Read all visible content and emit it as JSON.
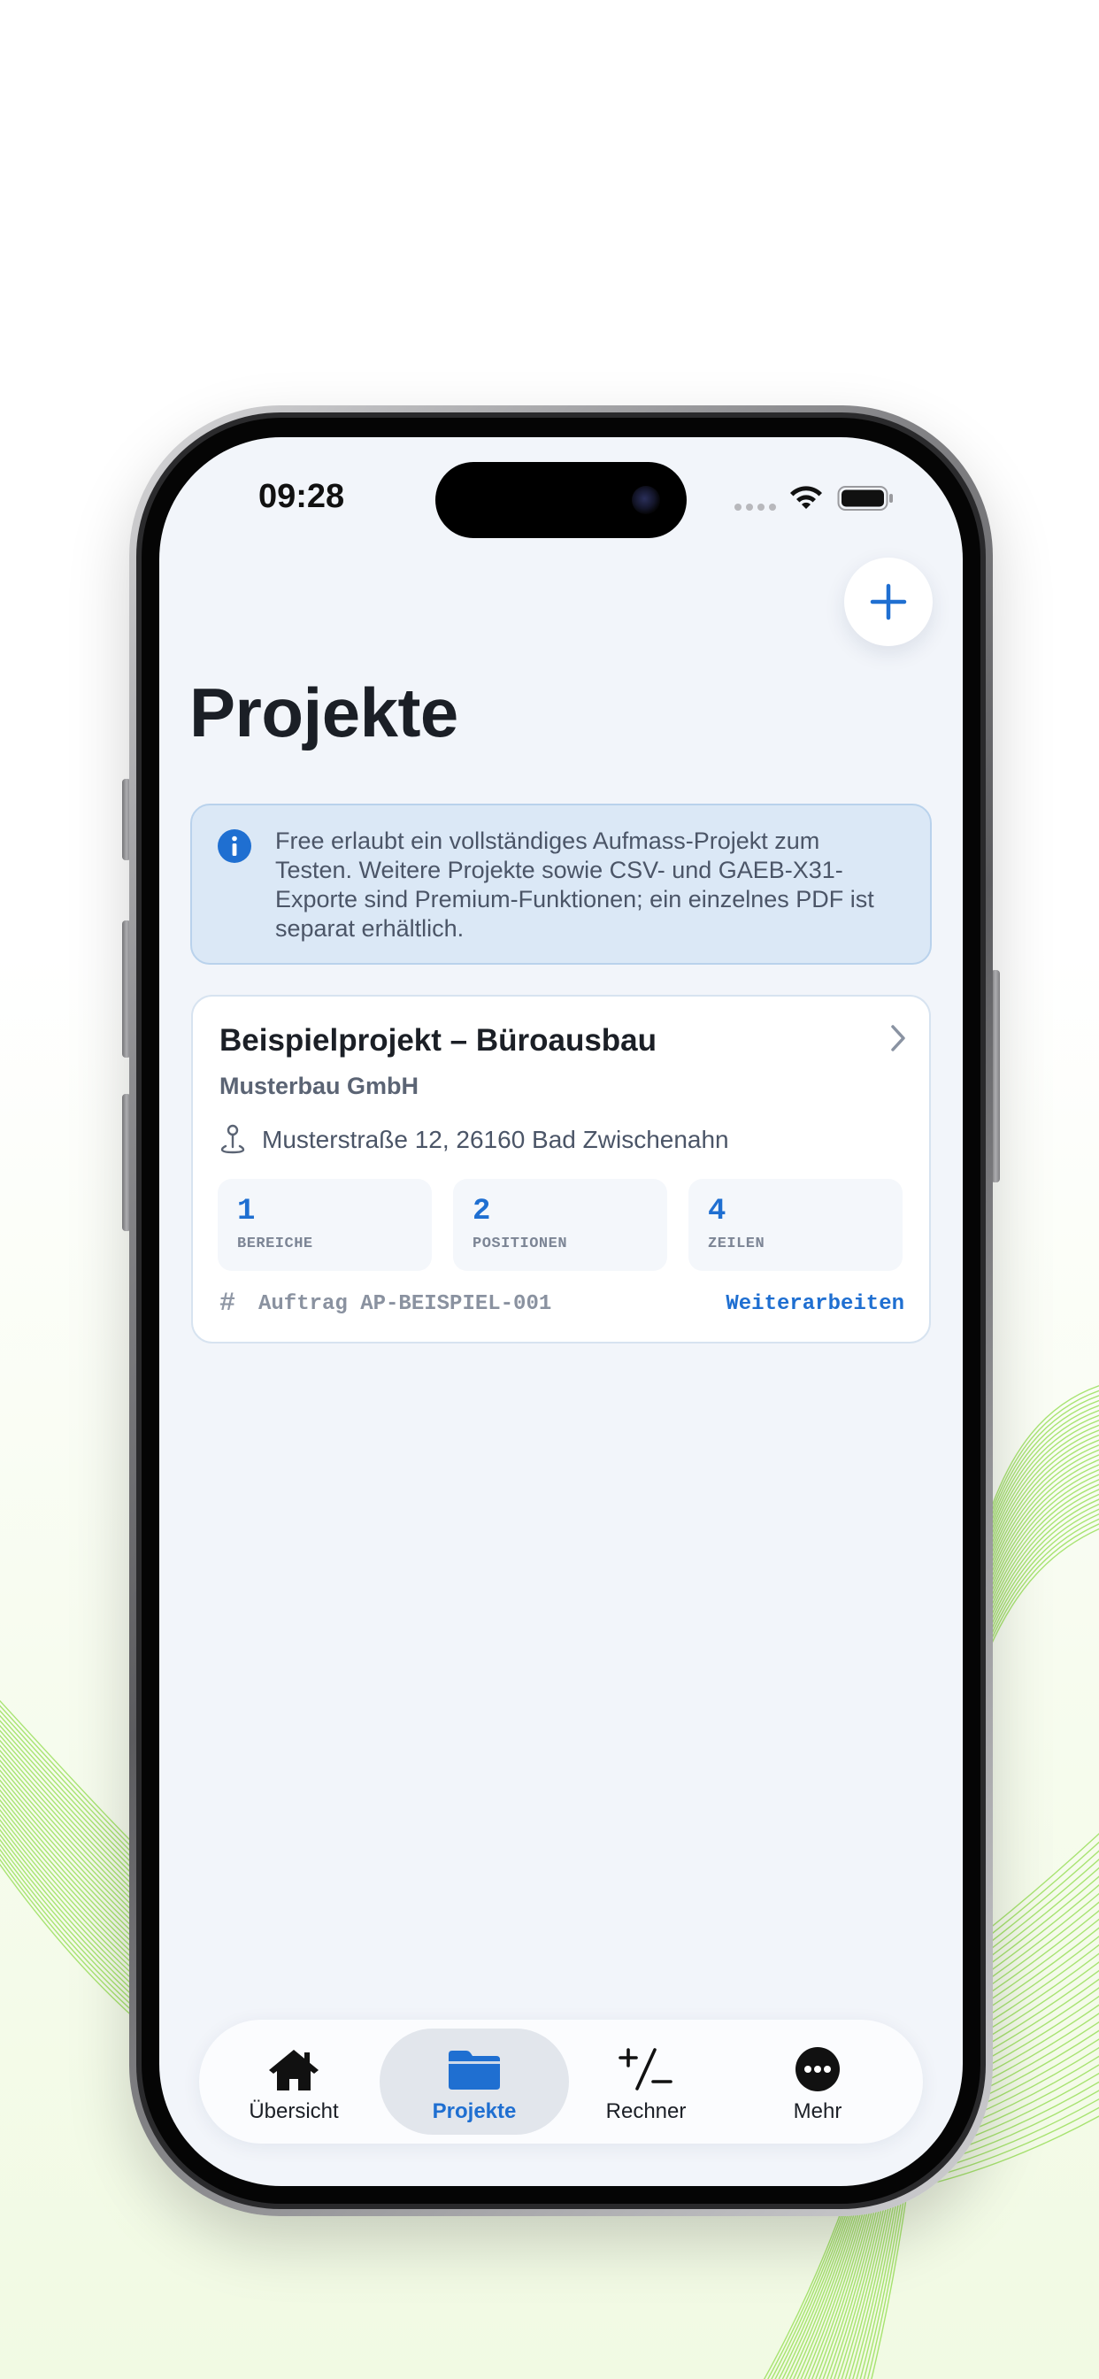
{
  "status_bar": {
    "time": "09:28"
  },
  "page": {
    "title": "Projekte"
  },
  "info_banner": {
    "text": "Free erlaubt ein vollständiges Aufmass-Projekt zum Testen. Weitere Projekte sowie CSV- und GAEB-X31-Exporte sind Premium-Funktionen; ein einzelnes PDF ist separat erhältlich."
  },
  "project": {
    "title": "Beispielprojekt – Büroausbau",
    "company": "Musterbau GmbH",
    "address": "Musterstraße 12, 26160 Bad Zwischenahn",
    "stats": [
      {
        "value": "1",
        "label": "BEREICHE"
      },
      {
        "value": "2",
        "label": "POSITIONEN"
      },
      {
        "value": "4",
        "label": "ZEILEN"
      }
    ],
    "order": "Auftrag AP-BEISPIEL-001",
    "continue_label": "Weiterarbeiten"
  },
  "tab_bar": {
    "active": "Projekte",
    "items": [
      {
        "label": "Übersicht",
        "icon": "house-icon"
      },
      {
        "label": "Projekte",
        "icon": "folder-icon"
      },
      {
        "label": "Rechner",
        "icon": "plus-minus-icon"
      },
      {
        "label": "Mehr",
        "icon": "more-icon"
      }
    ]
  },
  "colors": {
    "accent": "#1f6fd1",
    "screen_background": "#f2f5fa",
    "banner_background": "#dbe8f6",
    "wave_lines": "#8fdc4a"
  }
}
